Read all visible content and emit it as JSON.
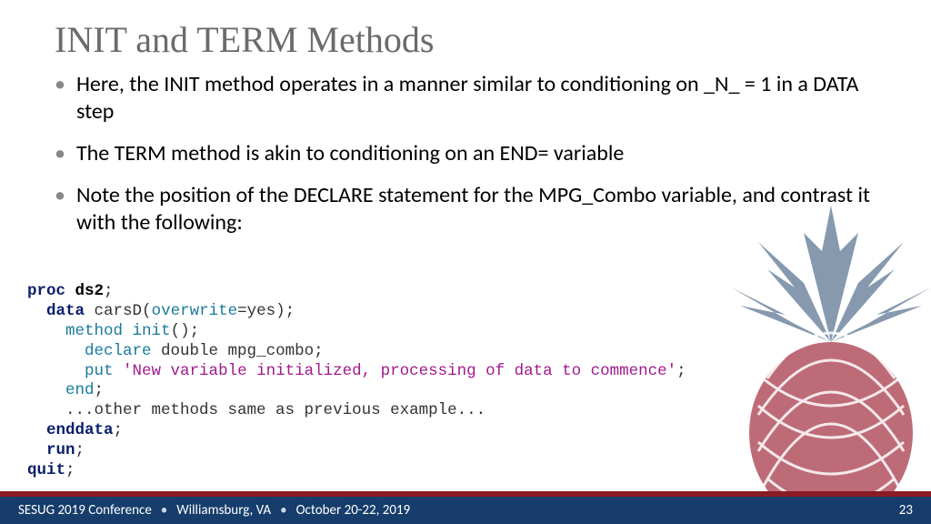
{
  "title": "INIT and TERM Methods",
  "bullets": [
    "Here, the INIT method operates in a manner similar to conditioning on _N_ = 1 in a DATA step",
    "The TERM method is akin to conditioning on an END= variable",
    "Note the position of the DECLARE statement for the MPG_Combo variable, and contrast it with the following:"
  ],
  "code": {
    "proc": "proc",
    "ds2": "ds2",
    "data": "data",
    "carsD": "carsD(",
    "overwrite": "overwrite",
    "eqyes": "=yes)",
    "method": "method",
    "init": "init",
    "parens": "()",
    "declare": "declare",
    "double": "double mpg_combo",
    "put": "put",
    "string": "'New variable initialized, processing of data to commence'",
    "end": "end",
    "other": "...other methods same as previous example...",
    "enddata": "enddata",
    "run": "run",
    "quit": "quit",
    "semi": ";"
  },
  "footer": {
    "conf": "SESUG 2019 Conference",
    "loc": "Williamsburg, VA",
    "date": "October 20-22, 2019",
    "page": "23"
  }
}
